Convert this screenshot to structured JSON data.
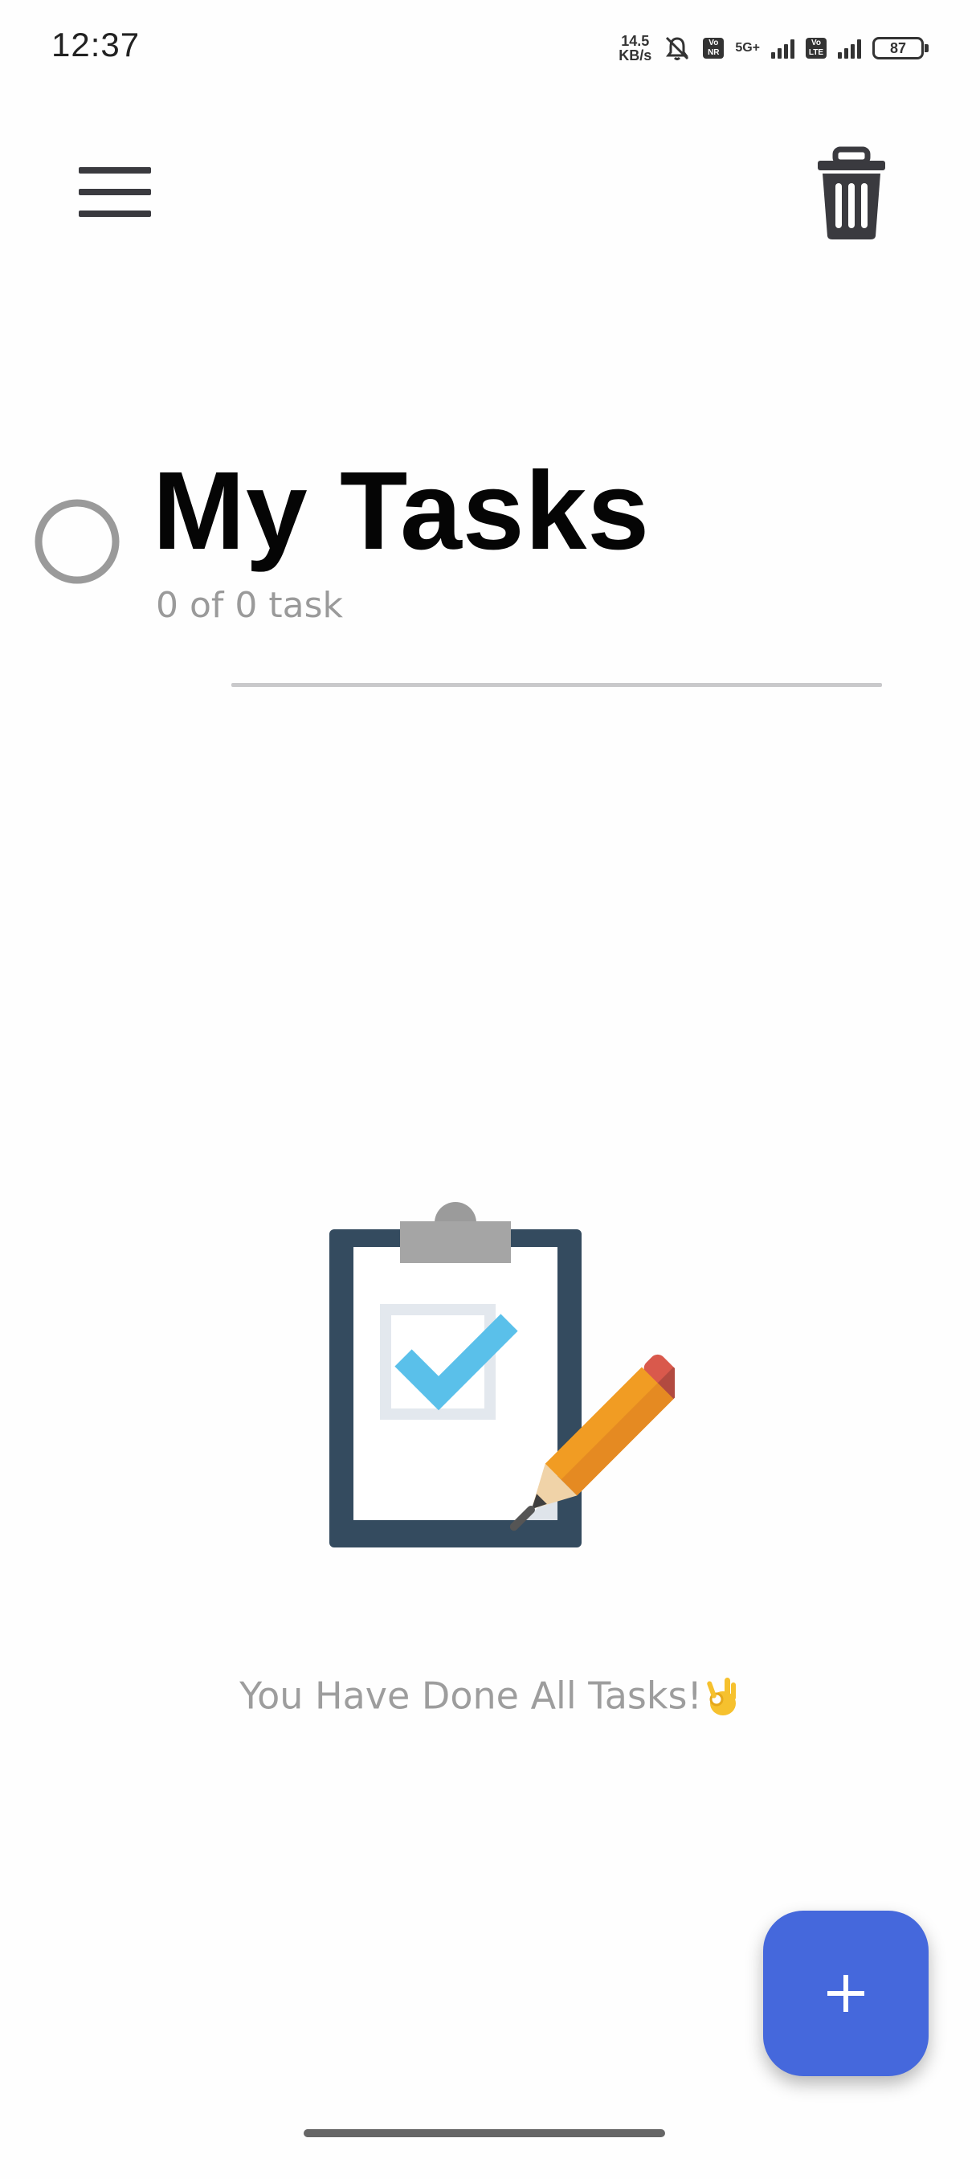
{
  "status_bar": {
    "time": "12:37",
    "net_speed_value": "14.5",
    "net_speed_unit": "KB/s",
    "volte_nr": "Vo NR",
    "network_type": "5G+",
    "volte_lte": "Vo LTE",
    "battery_level": "87",
    "icons": [
      "network-speed-icon",
      "mute-notification-icon",
      "vonr-icon",
      "5g-signal-icon",
      "volte-icon",
      "signal-icon",
      "battery-icon"
    ]
  },
  "toolbar": {
    "menu_icon": "hamburger-menu-icon",
    "delete_icon": "trash-icon"
  },
  "header": {
    "title": "My Tasks",
    "task_count": "0 of 0 task",
    "progress_fraction": 0
  },
  "empty_state": {
    "illustration": "clipboard-checkmark-pencil-illustration",
    "message": "You Have Done All Tasks!",
    "emoji_icon": "ok-hand-emoji"
  },
  "fab": {
    "icon": "plus-icon"
  },
  "colors": {
    "accent": "#4568dc",
    "title": "#050505",
    "muted_text": "#9a9a9a",
    "icon_dark": "#3a3a3f",
    "ring": "#9a9a9a",
    "divider": "#c9c9cb",
    "clipboard_board": "#344b5f",
    "checkmark": "#5ac0ea",
    "pencil": "#f19c23"
  }
}
